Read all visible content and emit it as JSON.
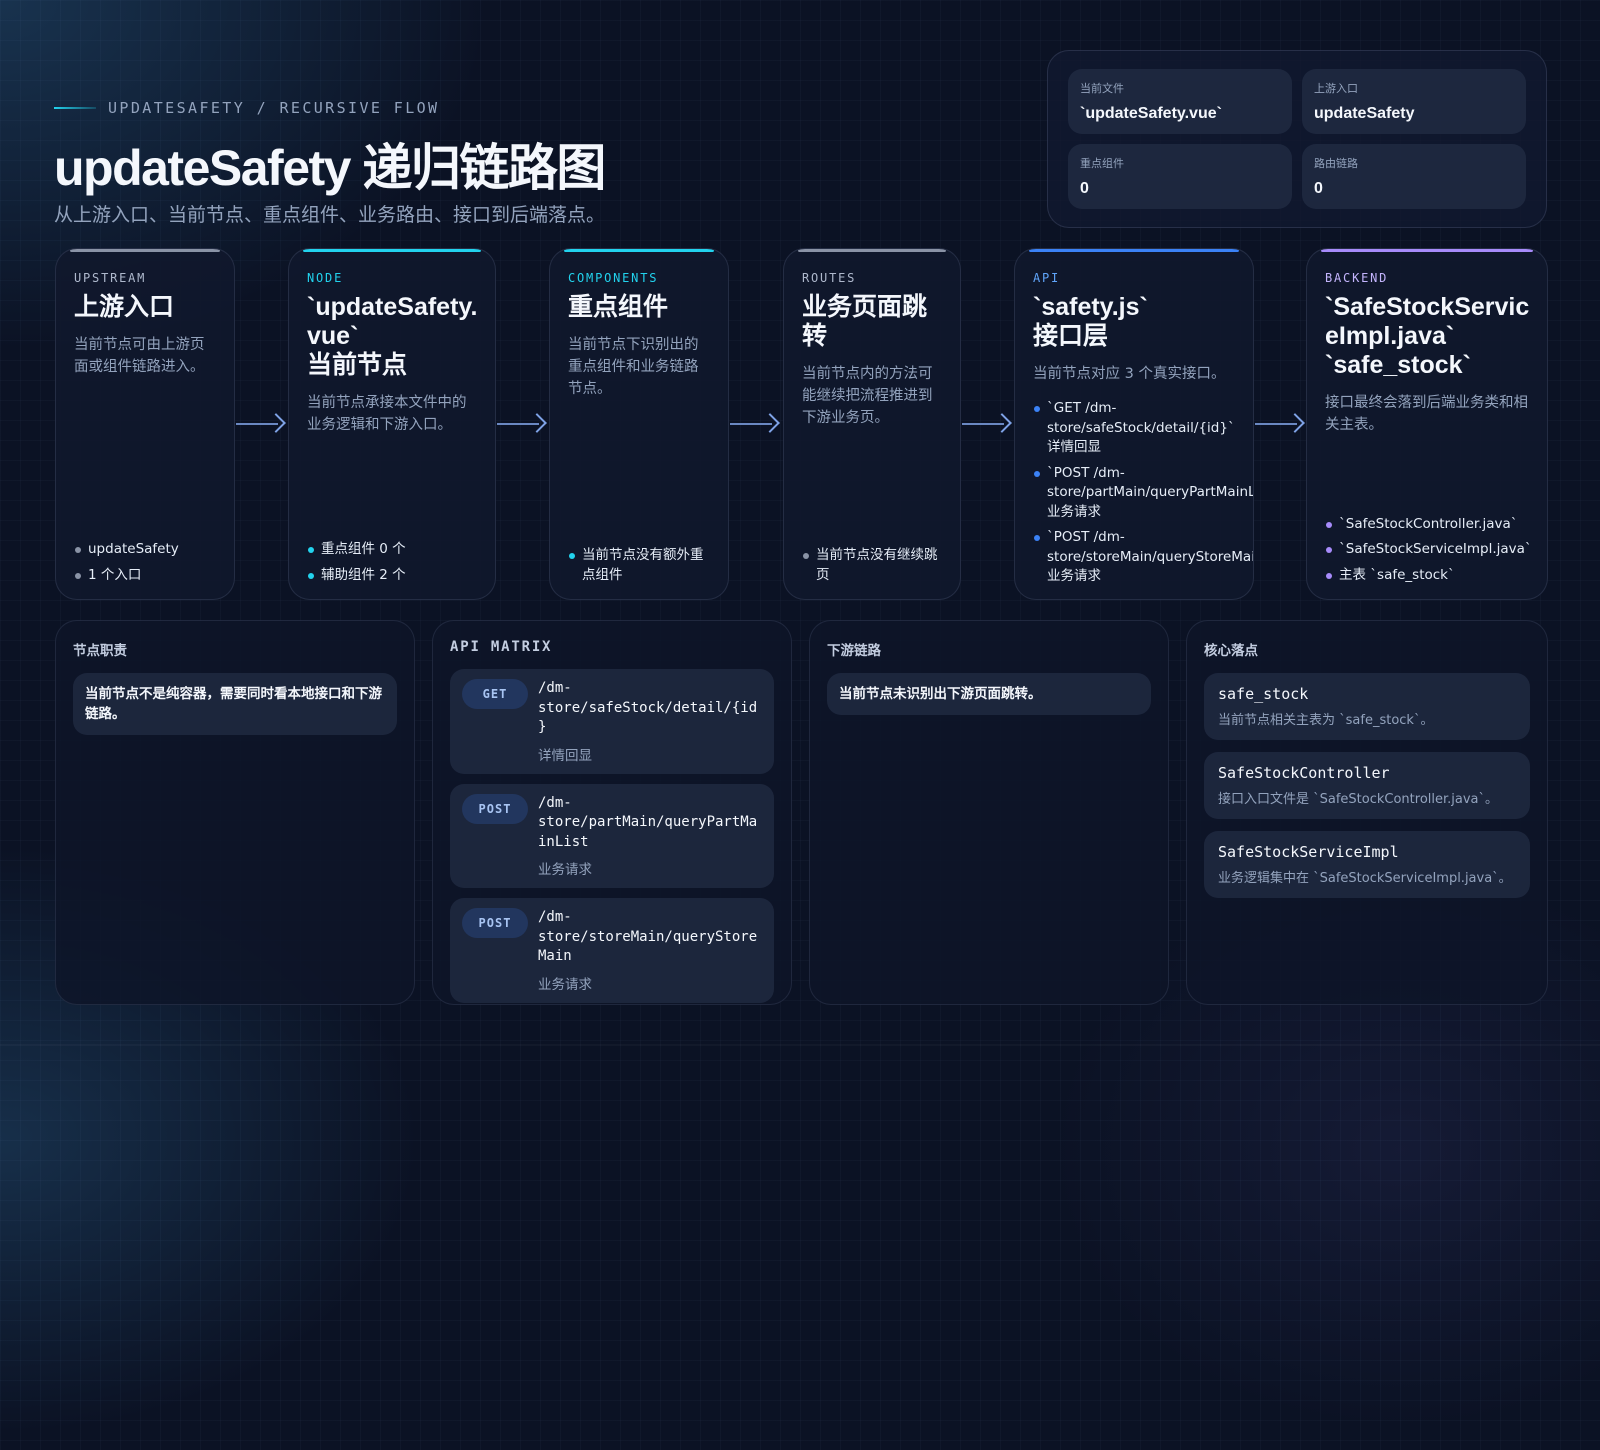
{
  "header": {
    "eyebrow": "UPDATESAFETY / RECURSIVE FLOW",
    "title": "updateSafety 递归链路图",
    "subtitle": "从上游入口、当前节点、重点组件、业务路由、接口到后端落点。"
  },
  "stats": [
    {
      "label": "当前文件",
      "value": "`updateSafety.vue`"
    },
    {
      "label": "上游入口",
      "value": "updateSafety"
    },
    {
      "label": "重点组件",
      "value": "0"
    },
    {
      "label": "路由链路",
      "value": "0"
    }
  ],
  "flow": [
    {
      "tag": "UPSTREAM",
      "title": "上游入口",
      "desc": "当前节点可由上游页面或组件链路进入。",
      "items": [
        "updateSafety",
        "1 个入口"
      ]
    },
    {
      "tag": "NODE",
      "title": "`updateSafety.\nvue`\n当前节点",
      "desc": "当前节点承接本文件中的业务逻辑和下游入口。",
      "items": [
        "重点组件 0 个",
        "辅助组件 2 个"
      ]
    },
    {
      "tag": "COMPONENTS",
      "title": "重点组件",
      "desc": "当前节点下识别出的重点组件和业务链路节点。",
      "items": [
        "当前节点没有额外重点组件"
      ]
    },
    {
      "tag": "ROUTES",
      "title": "业务页面跳\n转",
      "desc": "当前节点内的方法可能继续把流程推进到下游业务页。",
      "items": [
        "当前节点没有继续跳页"
      ]
    },
    {
      "tag": "API",
      "title": "`safety.js`\n接口层",
      "desc": "当前节点对应 3 个真实接口。",
      "items": [
        "`GET /dm-store/safeStock/detail/{id}` 详情回显",
        "`POST /dm-store/partMain/queryPartMainList` 业务请求",
        "`POST /dm-store/storeMain/queryStoreMain` 业务请求"
      ]
    },
    {
      "tag": "BACKEND",
      "title": "`SafeStockServic\neImpl.java`\n`safe_stock`",
      "desc": "接口最终会落到后端业务类和相关主表。",
      "items": [
        "`SafeStockController.java`",
        "`SafeStockServiceImpl.java`",
        "主表 `safe_stock`"
      ]
    }
  ],
  "panels": {
    "duty": {
      "title": "节点职责",
      "note": "当前节点不是纯容器，需要同时看本地接口和下游链路。"
    },
    "api_matrix": {
      "title": "API MATRIX",
      "items": [
        {
          "method": "GET",
          "path": "/dm-\nstore/safeStock/detail/{id\n}",
          "desc": "详情回显"
        },
        {
          "method": "POST",
          "path": "/dm-\nstore/partMain/queryPartMa\ninList",
          "desc": "业务请求"
        },
        {
          "method": "POST",
          "path": "/dm-\nstore/storeMain/queryStore\nMain",
          "desc": "业务请求"
        }
      ]
    },
    "downstream": {
      "title": "下游链路",
      "note": "当前节点未识别出下游页面跳转。"
    },
    "core": {
      "title": "核心落点",
      "items": [
        {
          "name": "safe_stock",
          "desc": "当前节点相关主表为 `safe_stock`。"
        },
        {
          "name": "SafeStockController",
          "desc": "接口入口文件是 `SafeStockController.java`。"
        },
        {
          "name": "SafeStockServiceImpl",
          "desc": "业务逻辑集中在 `SafeStockServiceImpl.java`。"
        }
      ]
    }
  },
  "colors": {
    "background": "#0b1224",
    "upstream_accent": "#8a93a6",
    "node_accent": "#22d3ee",
    "api_accent": "#3b82f6",
    "backend_accent": "#a78bfa",
    "text_muted": "#93a3bd"
  }
}
